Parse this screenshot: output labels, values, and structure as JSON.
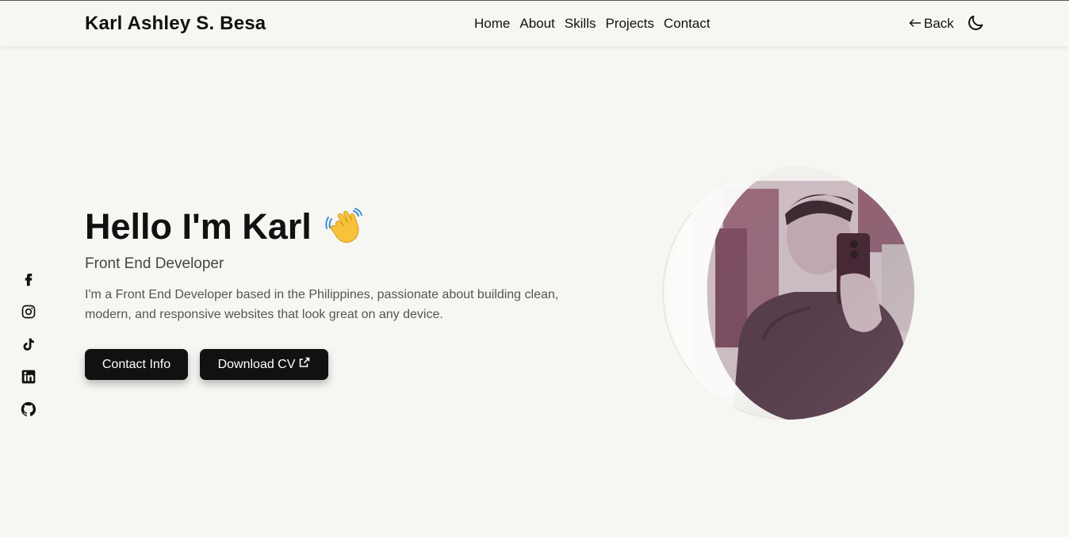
{
  "header": {
    "brand": "Karl Ashley S. Besa",
    "nav": [
      "Home",
      "About",
      "Skills",
      "Projects",
      "Contact"
    ],
    "back_label": "Back",
    "back_icon": "arrow-left-icon",
    "theme_icon": "moon-icon"
  },
  "socials": [
    "facebook-icon",
    "instagram-icon",
    "tiktok-icon",
    "linkedin-icon",
    "github-icon"
  ],
  "hero": {
    "title": "Hello I'm Karl",
    "role": "Front End Developer",
    "intro": "I'm a Front End Developer based in the Philippines, passionate about building clean, modern, and responsive websites that look great on any device.",
    "contact_button": "Contact Info",
    "cv_button": "Download CV"
  },
  "colors": {
    "background": "#f6f6f2",
    "text": "#111111",
    "button": "#111111",
    "button_text": "#ffffff"
  }
}
